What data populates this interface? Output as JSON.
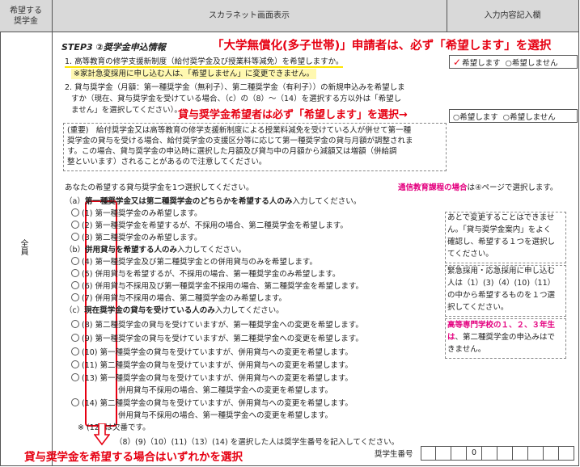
{
  "header": {
    "col1": "希望する\n奨学金",
    "col2": "スカラネット画面表示",
    "col3": "入力内容記入欄"
  },
  "row_label": "全員",
  "step_title": "STEP3 ②奨学金申込情報",
  "annot_top": "「大学無償化(多子世帯)」申請者は、必ず「希望します」を選択",
  "annot_mid": "貸与奨学金希望者は必ず「希望します」を選択→",
  "annot_bottom": "貸与奨学金を希望する場合はいずれかを選択",
  "q1": {
    "text": "1. 高等教育の修学支援新制度（給付奨学金及び授業料等減免）を希望しますか。",
    "note": "※家計急変採用に申し込む人は、「希望しません」に変更できません。"
  },
  "q2": {
    "line1": "2. 貸与奨学金（月額：第一種奨学金（無利子）、第二種奨学金（有利子））の新規申込みを希望しま",
    "line2": "すか（現在、貸与奨学金を受けている場合、（c）の（8）～（14）を選択する方以外は「希望し",
    "line3": "ません」を選択してください）。"
  },
  "answers": {
    "a1_yes": "希望します",
    "a1_no": "○希望しません",
    "a2_yes": "○希望します",
    "a2_no": "○希望しません"
  },
  "important": {
    "l1": "(重要)　給付奨学金又は高等教育の修学支援新制度による授業料減免を受けている人が併せて第一種",
    "l2": "奨学金の貸与を受ける場合、給付奨学金の支援区分等に応じて第一種奨学金の貸与月額が調整されま",
    "l3": "す。この場合、貸与奨学金の申込時に選択した月額及び貸与中の月額から減額又は増額（併給調",
    "l4": "整といいます）されることがあるので注意してください。"
  },
  "select_prompt": "あなたの希望する貸与奨学金を1つ選択してください。",
  "tsushin": {
    "a": "通信教育課程の場合",
    "b": "は④ページで選択します。"
  },
  "group_a": {
    "prefix": "（a）",
    "bold": "第一種奨学金又は第二種奨学金のどちらかを希望する人のみ",
    "suffix": "入力してください。"
  },
  "group_b": {
    "prefix": "（b）",
    "bold": "併用貸与を希望する人のみ",
    "suffix": "入力してください。"
  },
  "group_c": {
    "prefix": "（c）",
    "bold": "現在奨学金の貸与を受けている人のみ",
    "suffix": "入力してください。"
  },
  "options": [
    {
      "num": "(1)",
      "text": "第一種奨学金のみ希望します。"
    },
    {
      "num": "(2)",
      "text": "第一種奨学金を希望するが、不採用の場合、第二種奨学金を希望します。"
    },
    {
      "num": "(3)",
      "text": "第二種奨学金のみ希望します。"
    },
    {
      "num": "(4)",
      "text": "第一種奨学金及び第二種奨学金との併用貸与のみを希望します。"
    },
    {
      "num": "(5)",
      "text": "併用貸与を希望するが、不採用の場合、第一種奨学金のみ希望します。"
    },
    {
      "num": "(6)",
      "text": "併用貸与不採用及び第一種奨学金不採用の場合、第二種奨学金を希望します。"
    },
    {
      "num": "(7)",
      "text": "併用貸与不採用の場合、第二種奨学金のみ希望します。"
    },
    {
      "num": "(8)",
      "text": "第二種奨学金の貸与を受けていますが、第一種奨学金への変更を希望します。"
    },
    {
      "num": "(9)",
      "text": "第一種奨学金の貸与を受けていますが、第二種奨学金への変更を希望します。"
    },
    {
      "num": "(10)",
      "text": "第一種奨学金の貸与を受けていますが、併用貸与への変更を希望します。"
    },
    {
      "num": "(11)",
      "text": "第二種奨学金の貸与を受けていますが、併用貸与への変更を希望します。"
    },
    {
      "num": "(13)",
      "text": "第一種奨学金の貸与を受けていますが、併用貸与への変更を希望します。"
    },
    {
      "num": "(14)",
      "text": "第二種奨学金の貸与を受けていますが、併用貸与への変更を希望します。"
    }
  ],
  "cont13": "併用貸与不採用の場合、第二種奨学金への変更を希望します。",
  "cont14": "併用貸与不採用の場合、第一種奨学金への変更を希望します。",
  "note12": {
    "mark": "※",
    "num": "(12)",
    "text": "は欠番です。"
  },
  "footer_line": "（8）(9)（10）(11)（13）(14) を選択した人は奨学生番号を記入してください。",
  "student_no_label": "奨学生番号",
  "student_no_digit": "0",
  "side_note1": [
    "あとで変更することはできませ",
    "ん。「貸与奨学金案内」をよく",
    "確認し、希望する１つを選択し",
    "てください。"
  ],
  "side_note2": [
    "緊急採用・応急採用に申し込む",
    "人は（1）(3)（4）(10)（11）",
    "の中から希望するものを１つ選",
    "択してください。"
  ],
  "side_note3": {
    "a": "高等専門学校の１、２、３年生",
    "b": "は",
    "c": "、第二種奨学金の申込みはで",
    "d": "きません。"
  },
  "colors": {
    "red": "#e60012",
    "magenta": "#e4007f",
    "header_bg": "#d9d9d9",
    "highlight": "#ffe600"
  }
}
